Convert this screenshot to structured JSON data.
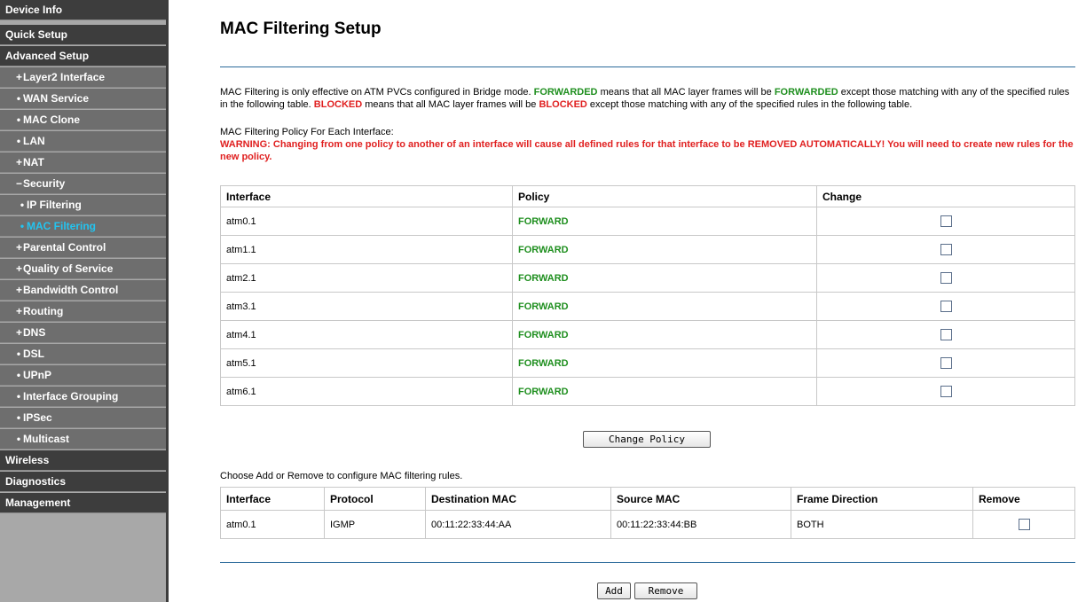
{
  "sidebar": {
    "items": [
      {
        "label": "Device Info",
        "marker": ""
      },
      {
        "label": "Quick Setup",
        "marker": ""
      },
      {
        "label": "Advanced Setup",
        "marker": ""
      },
      {
        "label": "Layer2 Interface",
        "marker": "+"
      },
      {
        "label": "WAN Service",
        "marker": "•"
      },
      {
        "label": "MAC Clone",
        "marker": "•"
      },
      {
        "label": "LAN",
        "marker": "•"
      },
      {
        "label": "NAT",
        "marker": "+"
      },
      {
        "label": "Security",
        "marker": "−"
      },
      {
        "label": "IP Filtering",
        "marker": "•"
      },
      {
        "label": "MAC Filtering",
        "marker": "•"
      },
      {
        "label": "Parental Control",
        "marker": "+"
      },
      {
        "label": "Quality of Service",
        "marker": "+"
      },
      {
        "label": "Bandwidth Control",
        "marker": "+"
      },
      {
        "label": "Routing",
        "marker": "+"
      },
      {
        "label": "DNS",
        "marker": "+"
      },
      {
        "label": "DSL",
        "marker": "•"
      },
      {
        "label": "UPnP",
        "marker": "•"
      },
      {
        "label": "Interface Grouping",
        "marker": "•"
      },
      {
        "label": "IPSec",
        "marker": "•"
      },
      {
        "label": "Multicast",
        "marker": "•"
      },
      {
        "label": "Wireless",
        "marker": ""
      },
      {
        "label": "Diagnostics",
        "marker": ""
      },
      {
        "label": "Management",
        "marker": ""
      }
    ],
    "active_color": "#23c4f0"
  },
  "main": {
    "title": "MAC Filtering Setup",
    "desc": {
      "p1": "MAC Filtering is only effective on ATM PVCs configured in Bridge mode. ",
      "forwarded1": "FORWARDED",
      "p2": " means that all MAC layer frames will be ",
      "forwarded2": "FORWARDED",
      "p3": " except those matching with any of the specified rules in the following table. ",
      "blocked1": "BLOCKED",
      "p4": " means that all MAC layer frames will be ",
      "blocked2": "BLOCKED",
      "p5": " except those matching with any of the specified rules in the following table."
    },
    "policy_heading": "MAC Filtering Policy For Each Interface:",
    "warning": "WARNING: Changing from one policy to another of an interface will cause all defined rules for that interface to be REMOVED AUTOMATICALLY! You will need to create new rules for the new policy.",
    "policy_table": {
      "headers": [
        "Interface",
        "Policy",
        "Change"
      ],
      "rows": [
        {
          "interface": "atm0.1",
          "policy": "FORWARD"
        },
        {
          "interface": "atm1.1",
          "policy": "FORWARD"
        },
        {
          "interface": "atm2.1",
          "policy": "FORWARD"
        },
        {
          "interface": "atm3.1",
          "policy": "FORWARD"
        },
        {
          "interface": "atm4.1",
          "policy": "FORWARD"
        },
        {
          "interface": "atm5.1",
          "policy": "FORWARD"
        },
        {
          "interface": "atm6.1",
          "policy": "FORWARD"
        }
      ]
    },
    "change_policy_label": "Change Policy",
    "rules_heading": "Choose Add or Remove to configure MAC filtering rules.",
    "rules_table": {
      "headers": [
        "Interface",
        "Protocol",
        "Destination MAC",
        "Source MAC",
        "Frame Direction",
        "Remove"
      ],
      "rows": [
        {
          "interface": "atm0.1",
          "protocol": "IGMP",
          "dest_mac": "00:11:22:33:44:AA",
          "src_mac": "00:11:22:33:44:BB",
          "direction": "BOTH"
        }
      ]
    },
    "add_label": "Add",
    "remove_label": "Remove",
    "colors": {
      "forward_green": "#1f8f1f",
      "warning_red": "#e02020",
      "rule_blue": "#2b6a9b"
    }
  }
}
